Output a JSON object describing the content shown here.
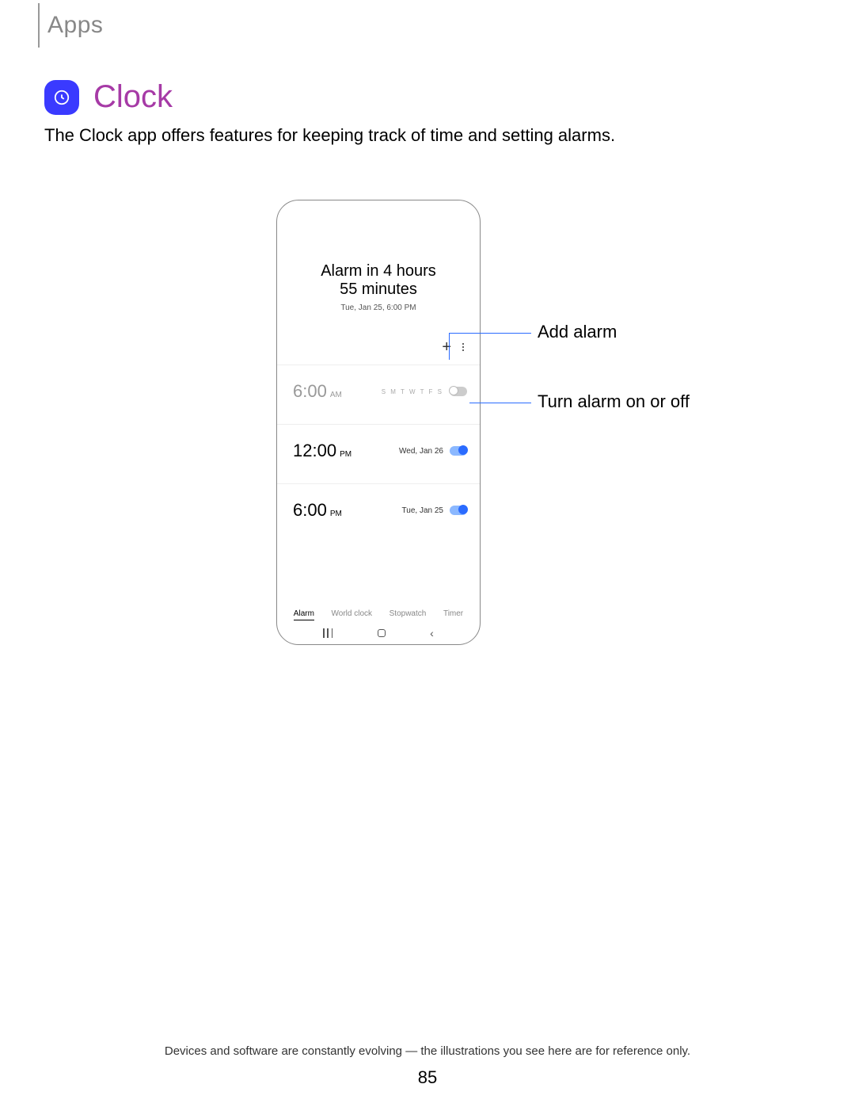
{
  "breadcrumb": "Apps",
  "heading": "Clock",
  "intro": "The Clock app offers features for keeping track of time and setting alarms.",
  "phone": {
    "header_line1": "Alarm in 4 hours",
    "header_line2": "55 minutes",
    "header_sub": "Tue, Jan 25, 6:00 PM",
    "alarms": [
      {
        "time": "6:00",
        "ampm": "AM",
        "repeat": "S M T W T F S",
        "on": false
      },
      {
        "time": "12:00",
        "ampm": "PM",
        "date": "Wed, Jan 26",
        "on": true
      },
      {
        "time": "6:00",
        "ampm": "PM",
        "date": "Tue, Jan 25",
        "on": true
      }
    ],
    "tabs": [
      "Alarm",
      "World clock",
      "Stopwatch",
      "Timer"
    ]
  },
  "callouts": {
    "add_alarm": "Add alarm",
    "toggle": "Turn alarm on or off"
  },
  "footer": "Devices and software are constantly evolving — the illustrations you see here are for reference only.",
  "page_number": "85"
}
